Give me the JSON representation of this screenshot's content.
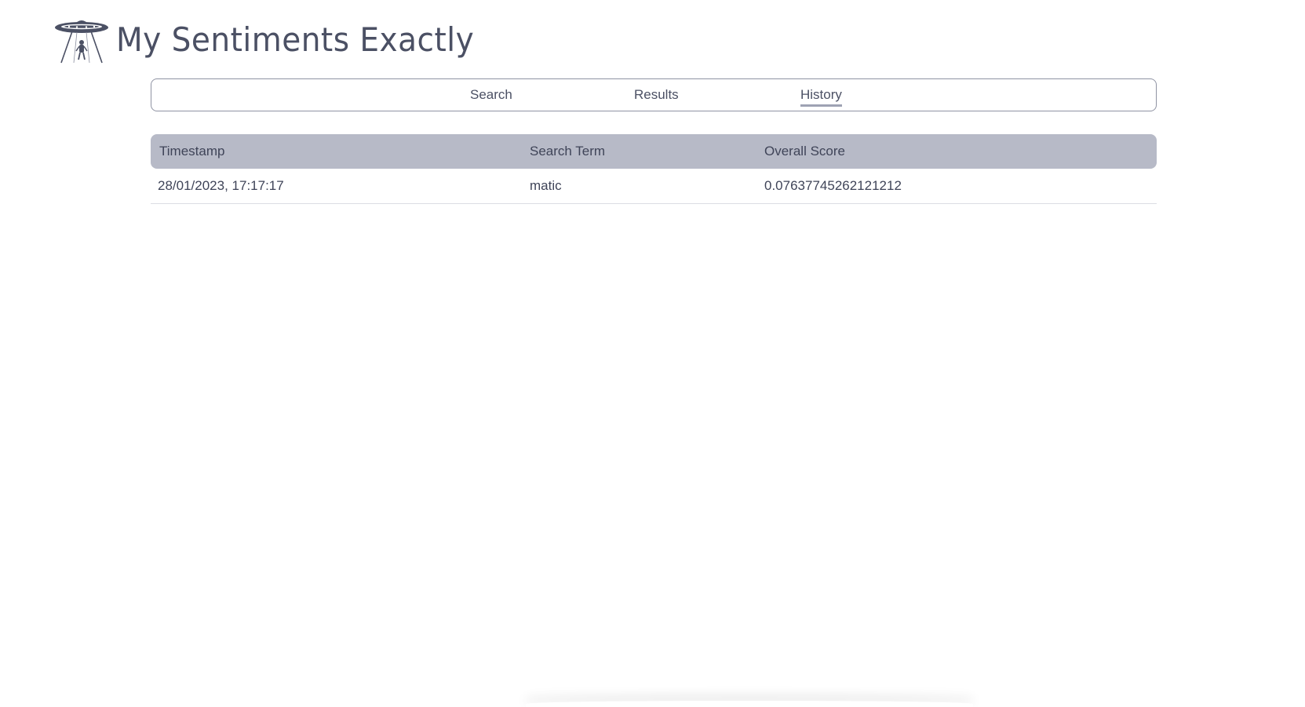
{
  "app": {
    "title": "My Sentiments Exactly",
    "logo_icon": "ufo-abduction-icon"
  },
  "nav": {
    "tabs": [
      {
        "label": "Search",
        "active": false
      },
      {
        "label": "Results",
        "active": false
      },
      {
        "label": "History",
        "active": true
      }
    ]
  },
  "history_table": {
    "columns": [
      "Timestamp",
      "Search Term",
      "Overall Score"
    ],
    "rows": [
      {
        "timestamp": "28/01/2023, 17:17:17",
        "search_term": "matic",
        "overall_score": "0.07637745262121212"
      }
    ]
  },
  "colors": {
    "text": "#444a5e",
    "header_bg": "#b7bac7",
    "nav_border": "#8f93a3",
    "active_underline": "#9ea2b3"
  }
}
